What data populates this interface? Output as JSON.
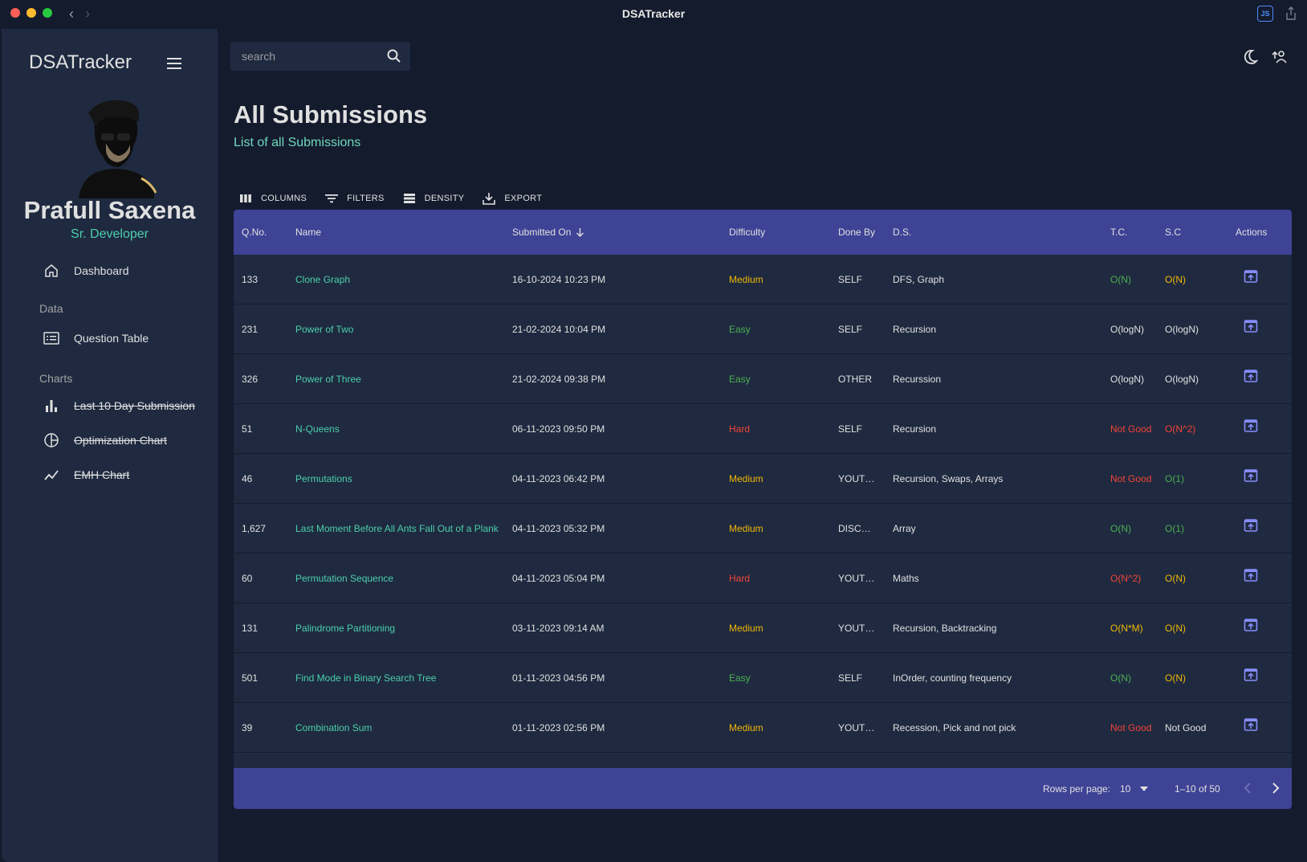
{
  "window": {
    "title": "DSATracker",
    "badge": "JS"
  },
  "sidebar": {
    "brand": "DSATracker",
    "profile": {
      "name": "Prafull Saxena",
      "role": "Sr. Developer"
    },
    "dashboard": "Dashboard",
    "sections": [
      {
        "label": "Data",
        "items": [
          {
            "label": "Question Table",
            "icon": "table-icon",
            "strike": false
          }
        ]
      },
      {
        "label": "Charts",
        "items": [
          {
            "label": "Last 10 Day Submission",
            "icon": "bar-chart-icon",
            "strike": true
          },
          {
            "label": "Optimization Chart",
            "icon": "pie-chart-icon",
            "strike": true
          },
          {
            "label": "EMH Chart",
            "icon": "line-chart-icon",
            "strike": true
          }
        ]
      }
    ]
  },
  "search": {
    "placeholder": "search"
  },
  "page": {
    "title": "All Submissions",
    "subtitle": "List of all Submissions"
  },
  "toolbar": {
    "columns": "COLUMNS",
    "filters": "FILTERS",
    "density": "DENSITY",
    "export": "EXPORT"
  },
  "table": {
    "headers": {
      "qno": "Q.No.",
      "name": "Name",
      "submitted": "Submitted On",
      "difficulty": "Difficulty",
      "done_by": "Done By",
      "ds": "D.S.",
      "tc": "T.C.",
      "sc": "S.C",
      "actions": "Actions"
    },
    "colors": {
      "Medium": "#f2b705",
      "Easy": "#4caf50",
      "Hard": "#f44336",
      "default": "#e0e0e0"
    },
    "rows": [
      {
        "qno": "133",
        "name": "Clone Graph",
        "submitted": "16-10-2024 10:23 PM",
        "difficulty": "Medium",
        "done_by": "SELF",
        "ds": "DFS, Graph",
        "tc": "O(N)",
        "tc_color": "#4caf50",
        "sc": "O(N)",
        "sc_color": "#f2b705"
      },
      {
        "qno": "231",
        "name": "Power of Two",
        "submitted": "21-02-2024 10:04 PM",
        "difficulty": "Easy",
        "done_by": "SELF",
        "ds": "Recursion",
        "tc": "O(logN)",
        "tc_color": "#e0e0e0",
        "sc": "O(logN)",
        "sc_color": "#e0e0e0"
      },
      {
        "qno": "326",
        "name": "Power of Three",
        "submitted": "21-02-2024 09:38 PM",
        "difficulty": "Easy",
        "done_by": "OTHER",
        "ds": "Recurssion",
        "tc": "O(logN)",
        "tc_color": "#e0e0e0",
        "sc": "O(logN)",
        "sc_color": "#e0e0e0"
      },
      {
        "qno": "51",
        "name": "N-Queens",
        "submitted": "06-11-2023 09:50 PM",
        "difficulty": "Hard",
        "done_by": "SELF",
        "ds": "Recursion",
        "tc": "Not Good",
        "tc_color": "#f44336",
        "sc": "O(N^2)",
        "sc_color": "#f44336"
      },
      {
        "qno": "46",
        "name": "Permutations",
        "submitted": "04-11-2023 06:42 PM",
        "difficulty": "Medium",
        "done_by": "YOUTUBE",
        "ds": "Recursion, Swaps, Arrays",
        "tc": "Not Good",
        "tc_color": "#f44336",
        "sc": "O(1)",
        "sc_color": "#4caf50"
      },
      {
        "qno": "1,627",
        "name": "Last Moment Before All Ants Fall Out of a Plank",
        "submitted": "04-11-2023 05:32 PM",
        "difficulty": "Medium",
        "done_by": "DISCUSS",
        "ds": "Array",
        "tc": "O(N)",
        "tc_color": "#4caf50",
        "sc": "O(1)",
        "sc_color": "#4caf50"
      },
      {
        "qno": "60",
        "name": "Permutation Sequence",
        "submitted": "04-11-2023 05:04 PM",
        "difficulty": "Hard",
        "done_by": "YOUTUBE",
        "ds": "Maths",
        "tc": "O(N^2)",
        "tc_color": "#f44336",
        "sc": "O(N)",
        "sc_color": "#f2b705"
      },
      {
        "qno": "131",
        "name": "Palindrome Partitioning",
        "submitted": "03-11-2023 09:14 AM",
        "difficulty": "Medium",
        "done_by": "YOUTUBE",
        "ds": "Recursion, Backtracking",
        "tc": "O(N*M)",
        "tc_color": "#f2b705",
        "sc": "O(N)",
        "sc_color": "#f2b705"
      },
      {
        "qno": "501",
        "name": "Find Mode in Binary Search Tree",
        "submitted": "01-11-2023 04:56 PM",
        "difficulty": "Easy",
        "done_by": "SELF",
        "ds": "InOrder, counting frequency",
        "tc": "O(N)",
        "tc_color": "#4caf50",
        "sc": "O(N)",
        "sc_color": "#f2b705"
      },
      {
        "qno": "39",
        "name": "Combination Sum",
        "submitted": "01-11-2023 02:56 PM",
        "difficulty": "Medium",
        "done_by": "YOUTUBE",
        "ds": "Recession, Pick and not pick",
        "tc": "Not Good",
        "tc_color": "#f44336",
        "sc": "Not Good",
        "sc_color": "#e0e0e0"
      }
    ]
  },
  "pagination": {
    "rows_label": "Rows per page:",
    "rows_value": "10",
    "range": "1–10 of 50"
  }
}
